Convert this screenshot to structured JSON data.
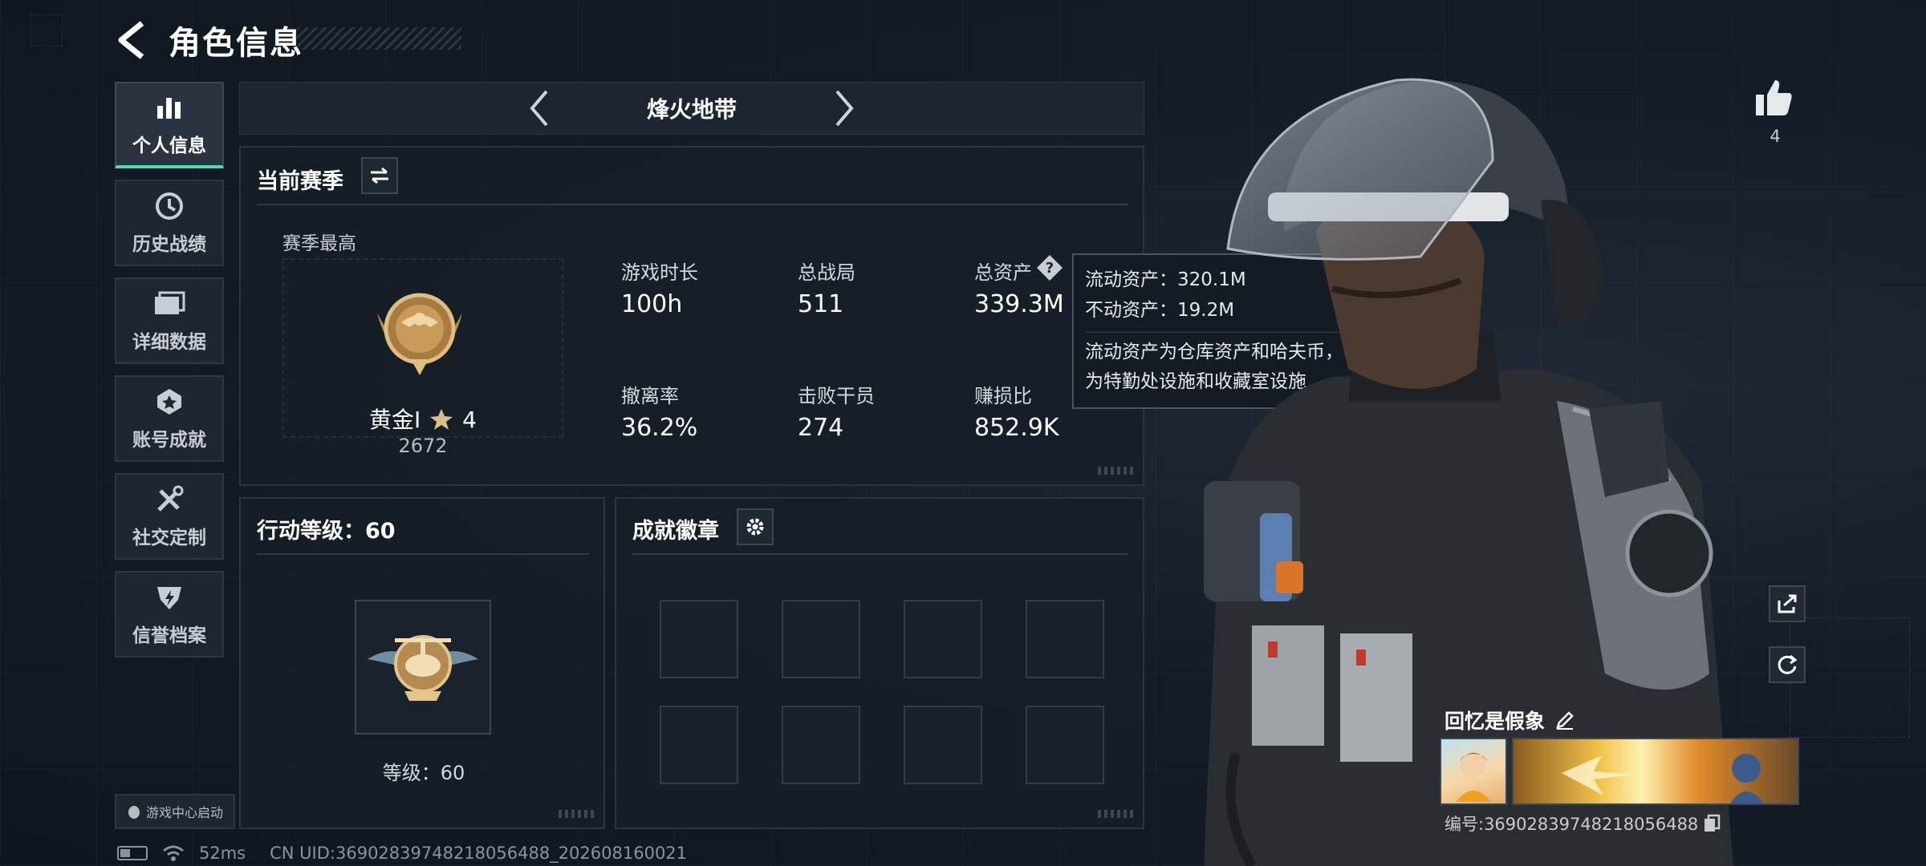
{
  "header": {
    "title": "角色信息"
  },
  "nav": {
    "items": [
      {
        "label": "个人信息",
        "icon": "bar-chart-icon"
      },
      {
        "label": "历史战绩",
        "icon": "history-icon"
      },
      {
        "label": "详细数据",
        "icon": "folder-icon"
      },
      {
        "label": "账号成就",
        "icon": "achievement-icon"
      },
      {
        "label": "社交定制",
        "icon": "tools-icon"
      },
      {
        "label": "信誉档案",
        "icon": "shield-icon"
      }
    ],
    "game_center": "游戏中心启动"
  },
  "status_bar": {
    "ping": "52ms",
    "uid": "CN UID:36902839748218056488_202608160021"
  },
  "mode": {
    "title": "烽火地带"
  },
  "season": {
    "title": "当前赛季",
    "best_label": "赛季最高",
    "rank_name": "黄金Ⅰ",
    "rank_stars": "4",
    "rank_score": "2672",
    "stats": [
      {
        "label": "游戏时长",
        "value": "100h"
      },
      {
        "label": "总战局",
        "value": "511"
      },
      {
        "label": "总资产",
        "value": "339.3M"
      },
      {
        "label": "撤离率",
        "value": "36.2%"
      },
      {
        "label": "击败干员",
        "value": "274"
      },
      {
        "label": "赚损比",
        "value": "852.9K"
      }
    ]
  },
  "tooltip": {
    "liquid": "流动资产：320.1M",
    "fixed": "不动资产：19.2M",
    "desc_line1": "流动资产为仓库资产和哈夫币，不动资产",
    "desc_line2": "为特勤处设施和收藏室设施"
  },
  "action_level": {
    "title": "行动等级：60",
    "label": "等级：60"
  },
  "achievements": {
    "title": "成就徽章"
  },
  "right": {
    "likes": "4",
    "card_name": "回忆是假象",
    "serial": "编号:36902839748218056488"
  },
  "colors": {
    "accent": "#48e0a6",
    "panel": "#161e28",
    "background": "#111a23"
  }
}
